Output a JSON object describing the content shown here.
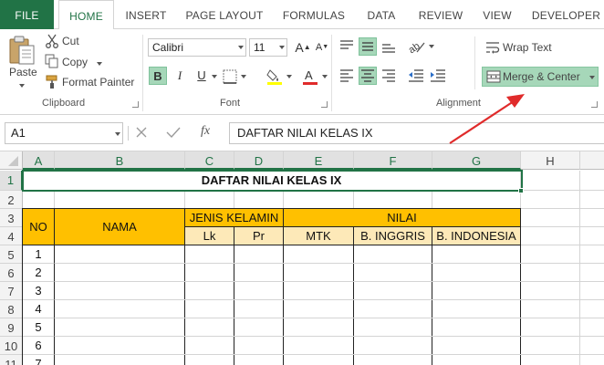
{
  "tabs": [
    "FILE",
    "HOME",
    "INSERT",
    "PAGE LAYOUT",
    "FORMULAS",
    "DATA",
    "REVIEW",
    "VIEW",
    "DEVELOPER"
  ],
  "clipboard": {
    "paste": "Paste",
    "cut": "Cut",
    "copy": "Copy",
    "format_painter": "Format Painter",
    "group": "Clipboard"
  },
  "font": {
    "name": "Calibri",
    "size": "11",
    "bold": "B",
    "italic": "I",
    "underline": "U",
    "group": "Font"
  },
  "alignment": {
    "wrap_text": "Wrap Text",
    "merge_center": "Merge & Center",
    "group": "Alignment"
  },
  "formula_bar": {
    "name_box": "A1",
    "fx": "fx",
    "content": "DAFTAR NILAI KELAS IX"
  },
  "columns": [
    "A",
    "B",
    "C",
    "D",
    "E",
    "F",
    "G",
    "H"
  ],
  "rows": [
    "1",
    "2",
    "3",
    "4",
    "5",
    "6",
    "7",
    "8",
    "9",
    "10",
    "11"
  ],
  "sheet": {
    "title": "DAFTAR NILAI KELAS IX",
    "no_header": "NO",
    "nama_header": "NAMA",
    "jenis_kelamin": "JENIS KELAMIN",
    "lk": "Lk",
    "pr": "Pr",
    "nilai": "NILAI",
    "mtk": "MTK",
    "b_inggris": "B. INGGRIS",
    "b_indonesia": "B. INDONESIA",
    "numbers": [
      "1",
      "2",
      "3",
      "4",
      "5",
      "6",
      "7"
    ]
  },
  "colors": {
    "accent": "#217346",
    "header_orange": "#ffc000",
    "header_light": "#fde9b8",
    "arrow": "#e02b2b"
  }
}
